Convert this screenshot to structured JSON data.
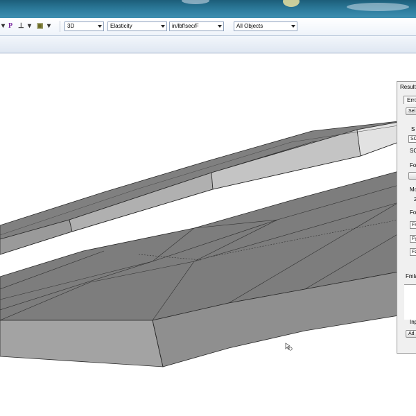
{
  "toolbar": {
    "view_mode": "3D",
    "result_type": "Elasticity",
    "units": "in/lbf/sec/F",
    "filter": "All Objects",
    "p_icon": "P"
  },
  "result_panel": {
    "title": "Result",
    "tab": "Erro",
    "select_button": "Sel",
    "label_s": "S",
    "field_sc": "SC",
    "label_sc": "SC",
    "label_fo1": "Fo",
    "label_mo": "Mo",
    "mo_value": "2",
    "label_fo2": "Fo",
    "field_fx": "Fx",
    "field_fy": "Fy",
    "field_fz": "Fz",
    "label_fmla": "Fmla",
    "label_inp": "Inp",
    "button_a": "Ad"
  },
  "colors": {
    "accent_bar": "#2f7fa0",
    "mesh_face": "#7d7d7d",
    "mesh_light": "#a8a8a8",
    "mesh_edge": "#333333"
  }
}
